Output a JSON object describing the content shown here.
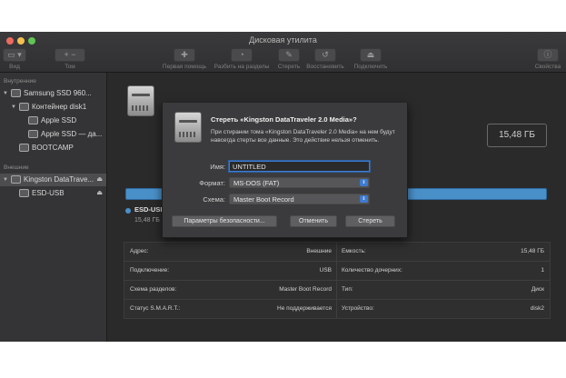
{
  "window": {
    "title": "Дисковая утилита"
  },
  "toolbar": {
    "items": [
      {
        "label": "Вид",
        "glyph": "▭ ▾"
      },
      {
        "label": "Том",
        "glyph": "+  −"
      },
      {
        "label": "Первая помощь",
        "glyph": "✚"
      },
      {
        "label": "Разбить на разделы",
        "glyph": "◔"
      },
      {
        "label": "Стереть",
        "glyph": "✎"
      },
      {
        "label": "Восстановить",
        "glyph": "↺"
      },
      {
        "label": "Подключить",
        "glyph": "⏏"
      },
      {
        "label": "Свойства",
        "glyph": "ⓘ"
      }
    ]
  },
  "sidebar": {
    "section_internal": "Внутренние",
    "section_external": "Внешние",
    "items": [
      {
        "label": "Samsung SSD 960..."
      },
      {
        "label": "Контейнер disk1"
      },
      {
        "label": "Apple SSD"
      },
      {
        "label": "Apple SSD — да..."
      },
      {
        "label": "BOOTCAMP"
      },
      {
        "label": "Kingston DataTrave..."
      },
      {
        "label": "ESD-USB"
      }
    ],
    "eject_glyph": "⏏"
  },
  "main": {
    "size": "15,48 ГБ",
    "partition_name": "ESD-USB",
    "partition_size": "15,48 ГБ",
    "info": {
      "left": [
        {
          "key": "Адрес:",
          "value": "Внешние"
        },
        {
          "key": "Подключение:",
          "value": "USB"
        },
        {
          "key": "Схема разделов:",
          "value": "Master Boot Record"
        },
        {
          "key": "Статус S.M.A.R.T.:",
          "value": "Не поддерживается"
        }
      ],
      "right": [
        {
          "key": "Емкость:",
          "value": "15,48 ГБ"
        },
        {
          "key": "Количество дочерних:",
          "value": "1"
        },
        {
          "key": "Тип:",
          "value": "Диск"
        },
        {
          "key": "Устройство:",
          "value": "disk2"
        }
      ]
    }
  },
  "dialog": {
    "title": "Стереть «Kingston DataTraveler 2.0 Media»?",
    "message": "При стирании тома «Kingston DataTraveler 2.0 Media» на нем будут навсегда стерты все данные. Это действие нельзя отменить.",
    "name_label": "Имя:",
    "name_value": "UNTITLED",
    "format_label": "Формат:",
    "format_value": "MS-DOS (FAT)",
    "scheme_label": "Схема:",
    "scheme_value": "Master Boot Record",
    "security_button": "Параметры безопасности...",
    "cancel_button": "Отменить",
    "erase_button": "Стереть"
  },
  "colors": {
    "accent": "#3d7bd1",
    "partition_bar": "#4a90c8"
  }
}
